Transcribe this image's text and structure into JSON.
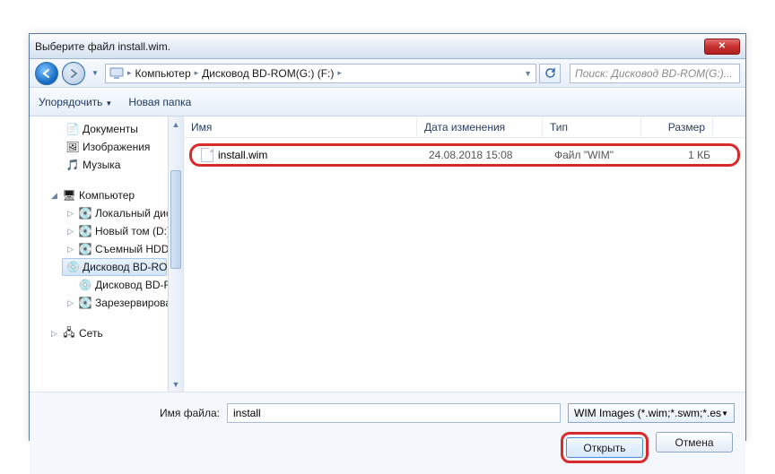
{
  "title": "Выберите файл install.wim.",
  "breadcrumb": {
    "root": "Компьютер",
    "path": "Дисковод BD-ROM(G:) (F:)"
  },
  "search_placeholder": "Поиск: Дисковод BD-ROM(G:)...",
  "toolbar": {
    "organize": "Упорядочить",
    "newfolder": "Новая папка"
  },
  "tree": {
    "docs": "Документы",
    "images": "Изображения",
    "music": "Музыка",
    "computer": "Компьютер",
    "local": "Локальный диск",
    "vol_d": "Новый том (D:)",
    "hdd": "Съемный HDD (",
    "bd1": "Дисковод BD-RO",
    "bd2": "Дисковод BD-RO",
    "reserved": "Зарезервирован",
    "network": "Сеть"
  },
  "columns": {
    "name": "Имя",
    "date": "Дата изменения",
    "type": "Тип",
    "size": "Размер"
  },
  "file": {
    "name": "install.wim",
    "date": "24.08.2018 15:08",
    "type": "Файл \"WIM\"",
    "size": "1 КБ"
  },
  "footer": {
    "label": "Имя файла:",
    "value": "install",
    "filter": "WIM Images (*.wim;*.swm;*.esd)",
    "open": "Открыть",
    "cancel": "Отмена"
  }
}
